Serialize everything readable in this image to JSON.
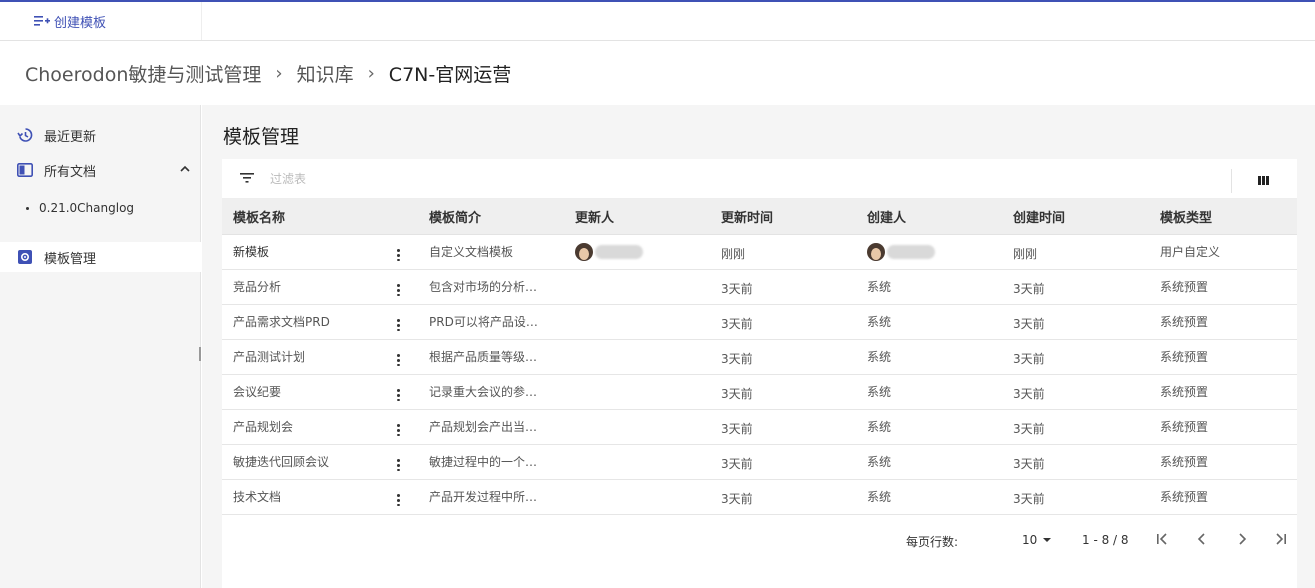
{
  "toolbar": {
    "create_template_label": "创建模板"
  },
  "breadcrumb": {
    "items": [
      "Choerodon敏捷与测试管理",
      "知识库",
      "C7N-官网运营"
    ]
  },
  "sidebar": {
    "recent_label": "最近更新",
    "all_docs_label": "所有文档",
    "sub_doc_label": "0.21.0Changlog",
    "template_mgmt_label": "模板管理"
  },
  "main": {
    "title": "模板管理",
    "filter_placeholder": "过滤表"
  },
  "table": {
    "headers": [
      "模板名称",
      "模板简介",
      "更新人",
      "更新时间",
      "创建人",
      "创建时间",
      "模板类型"
    ],
    "rows": [
      {
        "name": "新模板",
        "desc": "自定义文档模板",
        "updater": "",
        "update_time": "刚刚",
        "creator": "",
        "create_time": "刚刚",
        "type": "用户自定义"
      },
      {
        "name": "竞品分析",
        "desc": "包含对市场的分析…",
        "updater": "",
        "update_time": "3天前",
        "creator": "系统",
        "create_time": "3天前",
        "type": "系统预置"
      },
      {
        "name": "产品需求文档PRD",
        "desc": "PRD可以将产品设…",
        "updater": "",
        "update_time": "3天前",
        "creator": "系统",
        "create_time": "3天前",
        "type": "系统预置"
      },
      {
        "name": "产品测试计划",
        "desc": "根据产品质量等级…",
        "updater": "",
        "update_time": "3天前",
        "creator": "系统",
        "create_time": "3天前",
        "type": "系统预置"
      },
      {
        "name": "会议纪要",
        "desc": "记录重大会议的参…",
        "updater": "",
        "update_time": "3天前",
        "creator": "系统",
        "create_time": "3天前",
        "type": "系统预置"
      },
      {
        "name": "产品规划会",
        "desc": "产品规划会产出当…",
        "updater": "",
        "update_time": "3天前",
        "creator": "系统",
        "create_time": "3天前",
        "type": "系统预置"
      },
      {
        "name": "敏捷迭代回顾会议",
        "desc": "敏捷过程中的一个…",
        "updater": "",
        "update_time": "3天前",
        "creator": "系统",
        "create_time": "3天前",
        "type": "系统预置"
      },
      {
        "name": "技术文档",
        "desc": "产品开发过程中所…",
        "updater": "",
        "update_time": "3天前",
        "creator": "系统",
        "create_time": "3天前",
        "type": "系统预置"
      }
    ]
  },
  "pagination": {
    "page_size_label": "每页行数:",
    "page_size": "10",
    "range": "1 - 8 / 8"
  },
  "icons": {
    "create": "playlist-add-icon",
    "recent": "history-icon",
    "all_docs": "book-icon",
    "template": "settings-icon",
    "filter": "filter-icon",
    "columns": "column-icon"
  },
  "colors": {
    "accent": "#3f51b5",
    "sidebar_bg": "#f5f5f5",
    "header_bg": "#efefef"
  }
}
